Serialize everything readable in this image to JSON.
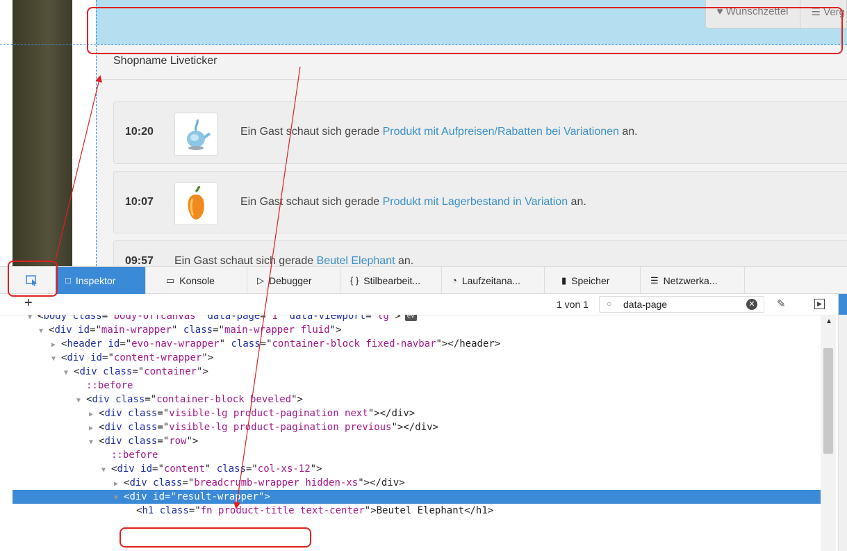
{
  "page": {
    "navbar": {
      "wishlist": "Wunschzettel",
      "compare": "Verg"
    },
    "shop_title": "Shopname Liveticker",
    "ticker": [
      {
        "time": "10:20",
        "prefix": "Ein Gast schaut sich gerade ",
        "link": "Produkt mit Aufpreisen/Rabatten bei Variationen",
        "suffix": " an."
      },
      {
        "time": "10:07",
        "prefix": "Ein Gast schaut sich gerade ",
        "link": "Produkt mit Lagerbestand in Variation",
        "suffix": " an."
      },
      {
        "time": "09:57",
        "prefix": "Ein Gast schaut sich gerade ",
        "link": "Beutel Elephant",
        "suffix": " an."
      }
    ]
  },
  "devtools": {
    "tabs": [
      {
        "label": "Inspektor",
        "icon": "□"
      },
      {
        "label": "Konsole",
        "icon": "▭"
      },
      {
        "label": "Debugger",
        "icon": "▷"
      },
      {
        "label": "Stilbearbeit...",
        "icon": "{ }"
      },
      {
        "label": "Laufzeitana...",
        "icon": "◔"
      },
      {
        "label": "Speicher",
        "icon": "▮"
      },
      {
        "label": "Netzwerka...",
        "icon": "☰"
      }
    ],
    "toolbar": {
      "plus": "+",
      "match_count": "1 von 1",
      "search_value": "data-page"
    },
    "tree": [
      {
        "pre": "<",
        "tag": "body",
        "attrs": [
          {
            "n": "class",
            "v": "body-offcanvas"
          },
          {
            "n": "data-page",
            "v": "1"
          },
          {
            "n": "data-viewport",
            "v": "lg"
          }
        ],
        "post": ">",
        "badge": "ev",
        "twisty": "▼"
      },
      {
        "pre": "<",
        "tag": "div",
        "attrs": [
          {
            "n": "id",
            "v": "main-wrapper"
          },
          {
            "n": "class",
            "v": "main-wrapper fluid"
          }
        ],
        "post": ">",
        "twisty": "▼"
      },
      {
        "pre": "<",
        "tag": "header",
        "attrs": [
          {
            "n": "id",
            "v": "evo-nav-wrapper"
          },
          {
            "n": "class",
            "v": "container-block fixed-navbar"
          }
        ],
        "post": "></header>",
        "twisty": "▶"
      },
      {
        "pre": "<",
        "tag": "div",
        "attrs": [
          {
            "n": "id",
            "v": "content-wrapper"
          }
        ],
        "post": ">",
        "twisty": "▼"
      },
      {
        "pre": "<",
        "tag": "div",
        "attrs": [
          {
            "n": "class",
            "v": "container"
          }
        ],
        "post": ">",
        "twisty": "▼"
      },
      {
        "pseudo": "::before"
      },
      {
        "pre": "<",
        "tag": "div",
        "attrs": [
          {
            "n": "class",
            "v": "container-block beveled"
          }
        ],
        "post": ">",
        "twisty": "▼"
      },
      {
        "pre": "<",
        "tag": "div",
        "attrs": [
          {
            "n": "class",
            "v": "visible-lg product-pagination next"
          }
        ],
        "post": "></div>",
        "twisty": "▶"
      },
      {
        "pre": "<",
        "tag": "div",
        "attrs": [
          {
            "n": "class",
            "v": "visible-lg product-pagination previous"
          }
        ],
        "post": "></div>",
        "twisty": "▶"
      },
      {
        "pre": "<",
        "tag": "div",
        "attrs": [
          {
            "n": "class",
            "v": "row"
          }
        ],
        "post": ">",
        "twisty": "▼"
      },
      {
        "pseudo": "::before"
      },
      {
        "pre": "<",
        "tag": "div",
        "attrs": [
          {
            "n": "id",
            "v": "content"
          },
          {
            "n": "class",
            "v": "col-xs-12"
          }
        ],
        "post": ">",
        "twisty": "▼"
      },
      {
        "pre": "<",
        "tag": "div",
        "attrs": [
          {
            "n": "class",
            "v": "breadcrumb-wrapper hidden-xs"
          }
        ],
        "post": "></div>",
        "twisty": "▶"
      },
      {
        "pre": "<",
        "tag": "div",
        "attrs": [
          {
            "n": "id",
            "v": "result-wrapper"
          }
        ],
        "post": ">",
        "twisty": "▼",
        "selected": true
      },
      {
        "pre": "<",
        "tag": "h1",
        "attrs": [
          {
            "n": "class",
            "v": "fn product-title text-center"
          }
        ],
        "post": ">Beutel Elephant</h1>",
        "twisty": ""
      }
    ]
  },
  "colors": {
    "accent": "#3b8ad8",
    "highlight": "#b3dff0",
    "annotation": "#e02020",
    "link": "#3a8fc8"
  }
}
